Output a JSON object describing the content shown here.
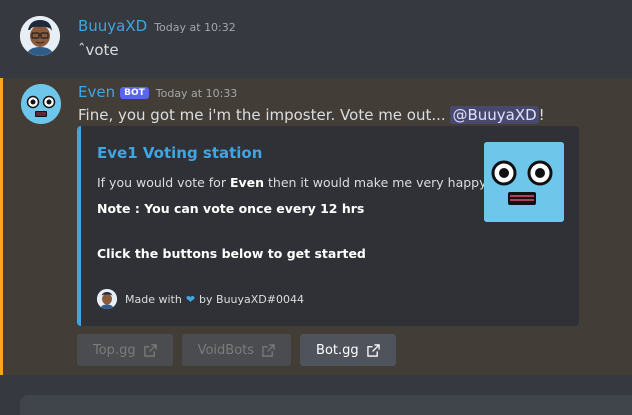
{
  "message1": {
    "username": "BuuyaXD",
    "timestamp": "Today at 10:32",
    "content": "ˆvote"
  },
  "message2": {
    "username": "Even",
    "badge": "BOT",
    "timestamp": "Today at 10:33",
    "content_text": "Fine, you got me i'm the imposter. Vote me out... ",
    "mention": "@BuuyaXD",
    "content_end": "!"
  },
  "embed": {
    "title": "Eve1 Voting station",
    "line1_prefix": "If you would vote for ",
    "line1_bold": "Even",
    "line1_suffix": " then it would make me very happy!",
    "line2": "Note : You can vote once every 12 hrs",
    "line3": "Click the buttons below to get started",
    "footer_prefix": "Made with",
    "footer_suffix": "by BuuyaXD#0044",
    "accent_color": "#3ea6e2"
  },
  "buttons": [
    {
      "label": "Top.gg",
      "icon": "external-link-icon",
      "disabled": true
    },
    {
      "label": "VoidBots",
      "icon": "external-link-icon",
      "disabled": true
    },
    {
      "label": "Bot.gg",
      "icon": "external-link-icon",
      "disabled": false
    }
  ],
  "colors": {
    "background": "#36393f",
    "highlight": "#423e37",
    "highlight_border": "#faa61a",
    "username": "#3ea6e2",
    "bot_badge": "#5865f2"
  }
}
